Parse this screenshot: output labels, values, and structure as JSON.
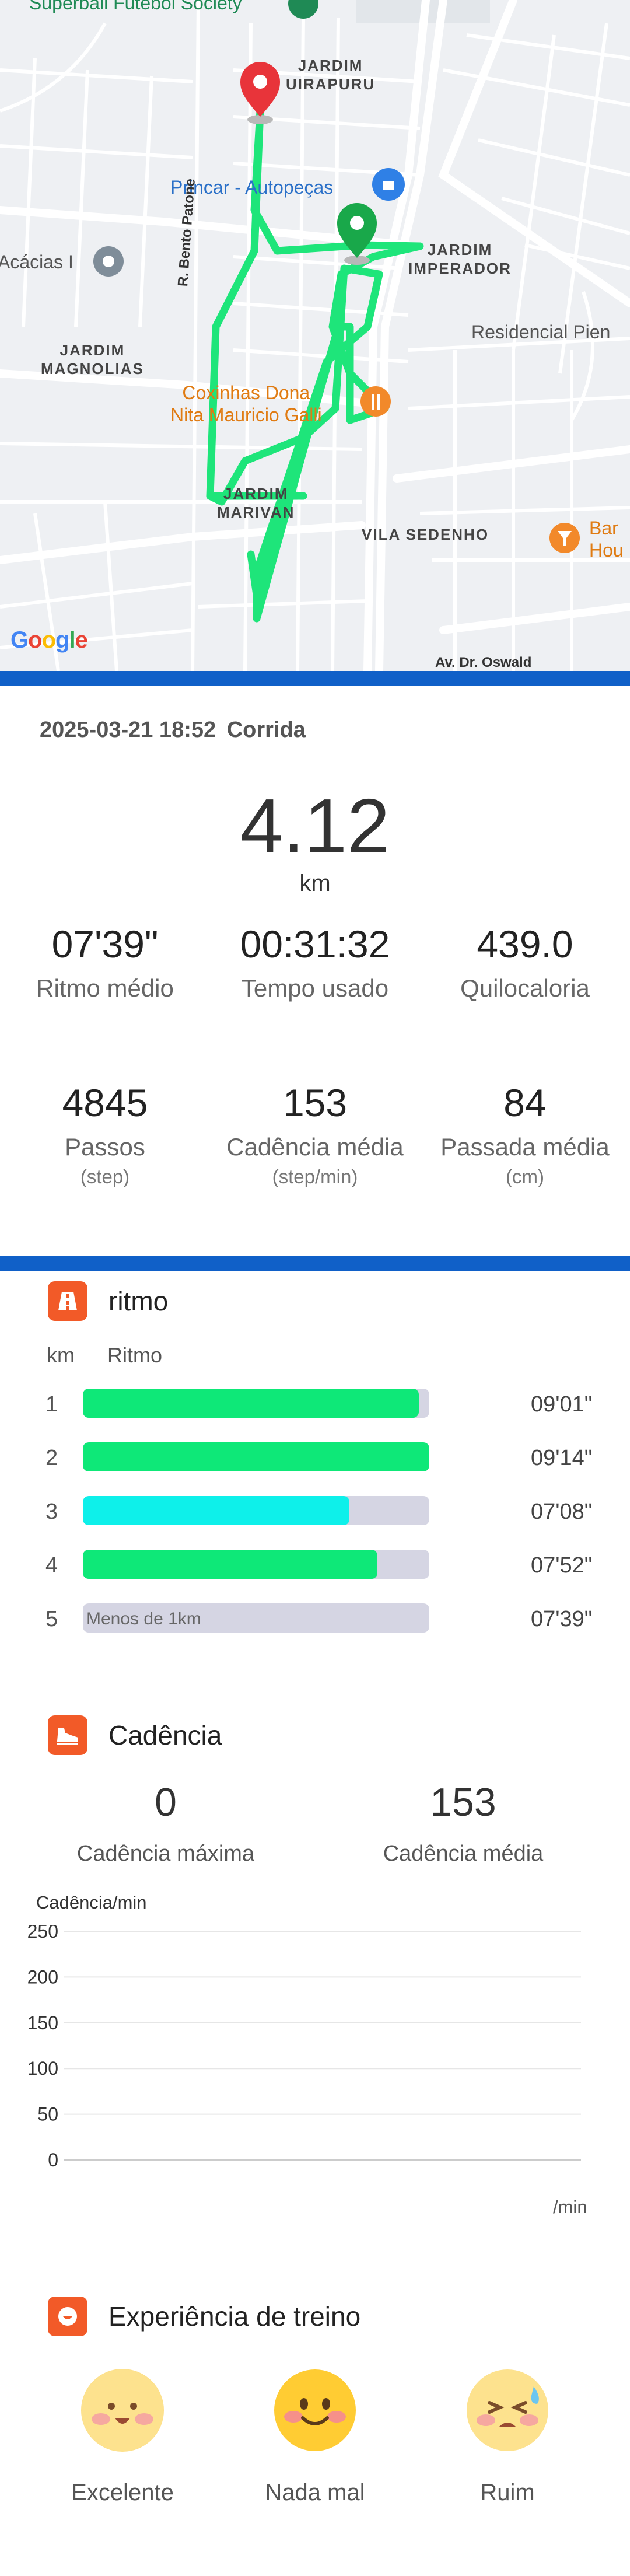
{
  "map": {
    "top_poi": "Superball Futebol Society",
    "labels": {
      "jardim_uirapuru": "JARDIM\nUIRAPURU",
      "jardim_imperador": "JARDIM\nIMPERADOR",
      "jardim_magnolias": "JARDIM\nMAGNOLIAS",
      "jardim_marivan": "JARDIM\nMARIVAN",
      "vila_sedenho": "VILA SEDENHO"
    },
    "pois": {
      "princar": "Princar - Autopeças",
      "acacias": "Acácias I",
      "residencial": "Residencial Pien",
      "coxinhas": "Coxinhas Dona\nNita Mauricio Galli",
      "bar": "Bar\nHou"
    },
    "streets": {
      "bento_patone": "R. Bento Patone",
      "oswald": "Av. Dr. Oswald"
    },
    "google": {
      "g1": "G",
      "o1": "o",
      "o2": "o",
      "g2": "g",
      "l": "l",
      "e": "e"
    }
  },
  "summary": {
    "datetime": "2025-03-21 18:52",
    "activity": "Corrida",
    "distance": "4.12",
    "distance_unit": "km",
    "row1": [
      {
        "value": "07'39\"",
        "label": "Ritmo médio"
      },
      {
        "value": "00:31:32",
        "label": "Tempo usado"
      },
      {
        "value": "439.0",
        "label": "Quilocaloria"
      }
    ],
    "row2": [
      {
        "value": "4845",
        "label": "Passos",
        "unit": "(step)"
      },
      {
        "value": "153",
        "label": "Cadência média",
        "unit": "(step/min)"
      },
      {
        "value": "84",
        "label": "Passada média",
        "unit": "(cm)"
      }
    ]
  },
  "pace": {
    "title": "ritmo",
    "col_km": "km",
    "col_pace": "Ritmo",
    "rows": [
      {
        "km": "1",
        "time": "09'01\"",
        "fraction": 0.97,
        "color": "#0ee878"
      },
      {
        "km": "2",
        "time": "09'14\"",
        "fraction": 1.0,
        "color": "#0ee878"
      },
      {
        "km": "3",
        "time": "07'08\"",
        "fraction": 0.77,
        "color": "#0ef0ea"
      },
      {
        "km": "4",
        "time": "07'52\"",
        "fraction": 0.85,
        "color": "#0ee878"
      },
      {
        "km": "5",
        "time": "07'39\"",
        "fraction": 0,
        "color": "#0ee878",
        "note": "Menos de 1km"
      }
    ]
  },
  "cadence": {
    "title": "Cadência",
    "max_value": "0",
    "max_label": "Cadência máxima",
    "avg_value": "153",
    "avg_label": "Cadência média",
    "axis_title": "Cadência/min",
    "x_unit": "/min",
    "chart_data": {
      "type": "line",
      "ylabel": "Cadência/min",
      "xlabel": "/min",
      "y_ticks": [
        "250",
        "200",
        "150",
        "100",
        "50",
        "0"
      ],
      "ylim": [
        0,
        250
      ],
      "grid": true,
      "series": []
    }
  },
  "experience": {
    "title": "Experiência de treino",
    "options": [
      {
        "label": "Excelente"
      },
      {
        "label": "Nada mal"
      },
      {
        "label": "Ruim"
      }
    ]
  },
  "colors": {
    "accent_orange": "#f25a28",
    "divider_blue": "#1060c8",
    "route_green": "#1ee57a",
    "pin_red": "#e8343a",
    "pin_green": "#19a84a"
  }
}
